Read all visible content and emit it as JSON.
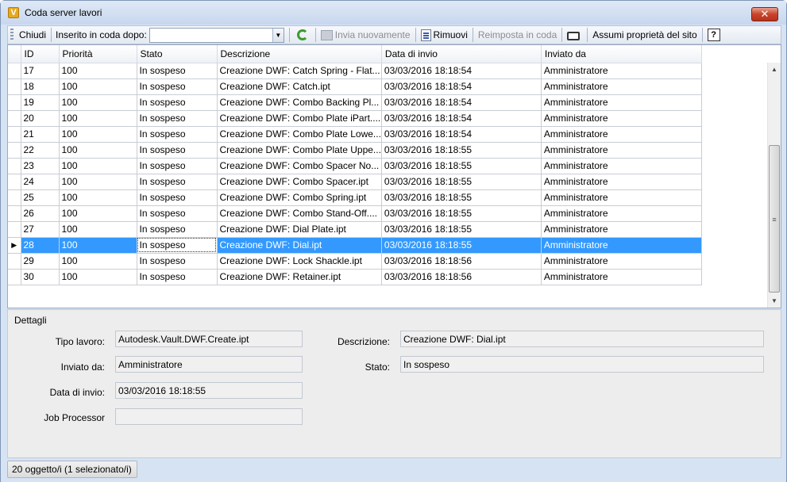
{
  "window": {
    "title": "Coda server lavori",
    "close_label": "✕"
  },
  "toolbar": {
    "close": "Chiudi",
    "queued_after_label": "Inserito in coda dopo:",
    "queued_after_value": "",
    "resubmit": "Invia nuovamente",
    "remove": "Rimuovi",
    "requeue": "Reimposta in coda",
    "site_ownership": "Assumi proprietà del sito",
    "help": "?"
  },
  "grid": {
    "columns": [
      "ID",
      "Priorità",
      "Stato",
      "Descrizione",
      "Data di invio",
      "Inviato da"
    ],
    "rows": [
      {
        "id": "17",
        "priority": "100",
        "status": "In sospeso",
        "description": "Creazione DWF: Catch Spring - Flat...",
        "date": "03/03/2016 18:18:54",
        "by": "Amministratore"
      },
      {
        "id": "18",
        "priority": "100",
        "status": "In sospeso",
        "description": "Creazione DWF: Catch.ipt",
        "date": "03/03/2016 18:18:54",
        "by": "Amministratore"
      },
      {
        "id": "19",
        "priority": "100",
        "status": "In sospeso",
        "description": "Creazione DWF: Combo Backing Pl...",
        "date": "03/03/2016 18:18:54",
        "by": "Amministratore"
      },
      {
        "id": "20",
        "priority": "100",
        "status": "In sospeso",
        "description": "Creazione DWF: Combo Plate iPart....",
        "date": "03/03/2016 18:18:54",
        "by": "Amministratore"
      },
      {
        "id": "21",
        "priority": "100",
        "status": "In sospeso",
        "description": "Creazione DWF: Combo Plate Lowe...",
        "date": "03/03/2016 18:18:54",
        "by": "Amministratore"
      },
      {
        "id": "22",
        "priority": "100",
        "status": "In sospeso",
        "description": "Creazione DWF: Combo Plate Uppe...",
        "date": "03/03/2016 18:18:55",
        "by": "Amministratore"
      },
      {
        "id": "23",
        "priority": "100",
        "status": "In sospeso",
        "description": "Creazione DWF: Combo Spacer No...",
        "date": "03/03/2016 18:18:55",
        "by": "Amministratore"
      },
      {
        "id": "24",
        "priority": "100",
        "status": "In sospeso",
        "description": "Creazione DWF: Combo Spacer.ipt",
        "date": "03/03/2016 18:18:55",
        "by": "Amministratore"
      },
      {
        "id": "25",
        "priority": "100",
        "status": "In sospeso",
        "description": "Creazione DWF: Combo Spring.ipt",
        "date": "03/03/2016 18:18:55",
        "by": "Amministratore"
      },
      {
        "id": "26",
        "priority": "100",
        "status": "In sospeso",
        "description": "Creazione DWF: Combo Stand-Off....",
        "date": "03/03/2016 18:18:55",
        "by": "Amministratore"
      },
      {
        "id": "27",
        "priority": "100",
        "status": "In sospeso",
        "description": "Creazione DWF: Dial Plate.ipt",
        "date": "03/03/2016 18:18:55",
        "by": "Amministratore"
      },
      {
        "id": "28",
        "priority": "100",
        "status": "In sospeso",
        "description": "Creazione DWF: Dial.ipt",
        "date": "03/03/2016 18:18:55",
        "by": "Amministratore"
      },
      {
        "id": "29",
        "priority": "100",
        "status": "In sospeso",
        "description": "Creazione DWF: Lock Shackle.ipt",
        "date": "03/03/2016 18:18:56",
        "by": "Amministratore"
      },
      {
        "id": "30",
        "priority": "100",
        "status": "In sospeso",
        "description": "Creazione DWF: Retainer.ipt",
        "date": "03/03/2016 18:18:56",
        "by": "Amministratore"
      }
    ],
    "selected_row_id": "28",
    "row_marker": "▶"
  },
  "details": {
    "title": "Dettagli",
    "job_type_label": "Tipo lavoro:",
    "job_type": "Autodesk.Vault.DWF.Create.ipt",
    "sent_by_label": "Inviato da:",
    "sent_by": "Amministratore",
    "date_label": "Data di invio:",
    "date": "03/03/2016 18:18:55",
    "processor_label": "Job Processor",
    "processor": "",
    "description_label": "Descrizione:",
    "description": "Creazione DWF: Dial.ipt",
    "status_label": "Stato:",
    "status": "In sospeso"
  },
  "statusbar": {
    "text": "20 oggetto/i (1 selezionato/i)"
  },
  "colors": {
    "selection": "#3399ff",
    "window_chrome": "#d6e3f3",
    "refresh_icon": "#3d9b2b",
    "close_button": "#c8432b"
  }
}
